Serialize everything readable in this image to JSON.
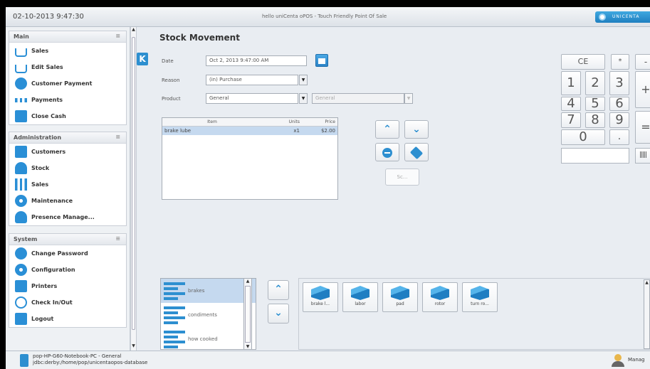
{
  "titlebar": {
    "datetime": "02-10-2013 9:47:30",
    "title": "hello uniCenta oPOS - Touch Friendly Point Of Sale",
    "logo_text": "UNICENTA"
  },
  "menu": {
    "groups": [
      {
        "title": "Main",
        "items": [
          {
            "label": "Sales",
            "icon": "cart-icon"
          },
          {
            "label": "Edit Sales",
            "icon": "cart-edit-icon"
          },
          {
            "label": "Customer Payment",
            "icon": "customer-payment-icon"
          },
          {
            "label": "Payments",
            "icon": "payments-icon"
          },
          {
            "label": "Close Cash",
            "icon": "calculator-icon"
          }
        ]
      },
      {
        "title": "Administration",
        "items": [
          {
            "label": "Customers",
            "icon": "customers-icon"
          },
          {
            "label": "Stock",
            "icon": "stock-icon"
          },
          {
            "label": "Sales",
            "icon": "sales-chart-icon"
          },
          {
            "label": "Maintenance",
            "icon": "maintenance-icon"
          },
          {
            "label": "Presence Manage...",
            "icon": "presence-icon"
          }
        ]
      },
      {
        "title": "System",
        "items": [
          {
            "label": "Change Password",
            "icon": "key-icon"
          },
          {
            "label": "Configuration",
            "icon": "gear-icon"
          },
          {
            "label": "Printers",
            "icon": "printer-icon"
          },
          {
            "label": "Check In/Out",
            "icon": "clock-icon"
          },
          {
            "label": "Logout",
            "icon": "logout-icon"
          }
        ]
      }
    ]
  },
  "main": {
    "heading": "Stock Movement",
    "k_button": "K",
    "date_label": "Date",
    "date_value": "Oct 2, 2013 9:47:00 AM",
    "reason_label": "Reason",
    "reason_value": "(in) Purchase",
    "product_label": "Product",
    "product_value": "General",
    "product_sub_value": "General",
    "table": {
      "columns": [
        "Item",
        "Units",
        "Price"
      ],
      "rows": [
        {
          "item": "brake lube",
          "units": "x1",
          "price": "$2.00"
        }
      ]
    },
    "sc_button": "Sc..."
  },
  "keypad": {
    "ce": "CE",
    "multiply": "*",
    "minus": "-",
    "plus": "+",
    "equals": "=",
    "dot": ".",
    "digits": [
      "1",
      "2",
      "3",
      "4",
      "5",
      "6",
      "7",
      "8",
      "9",
      "0"
    ],
    "barcode": "|||||"
  },
  "categories": [
    {
      "label": "brakes",
      "selected": true
    },
    {
      "label": "condiments",
      "selected": false
    },
    {
      "label": "how cooked",
      "selected": false
    }
  ],
  "products": [
    {
      "label": "brake l..."
    },
    {
      "label": "labor"
    },
    {
      "label": "pad"
    },
    {
      "label": "rotor"
    },
    {
      "label": "turn ro..."
    }
  ],
  "status": {
    "line1": "pop-HP-G60-Notebook-PC - General",
    "line2": "jdbc:derby:/home/pop/unicentaopos-database",
    "user": "Manag"
  },
  "colors": {
    "accent": "#2d8fd0",
    "selection": "#c5d9ef",
    "background": "#e9edf2"
  }
}
